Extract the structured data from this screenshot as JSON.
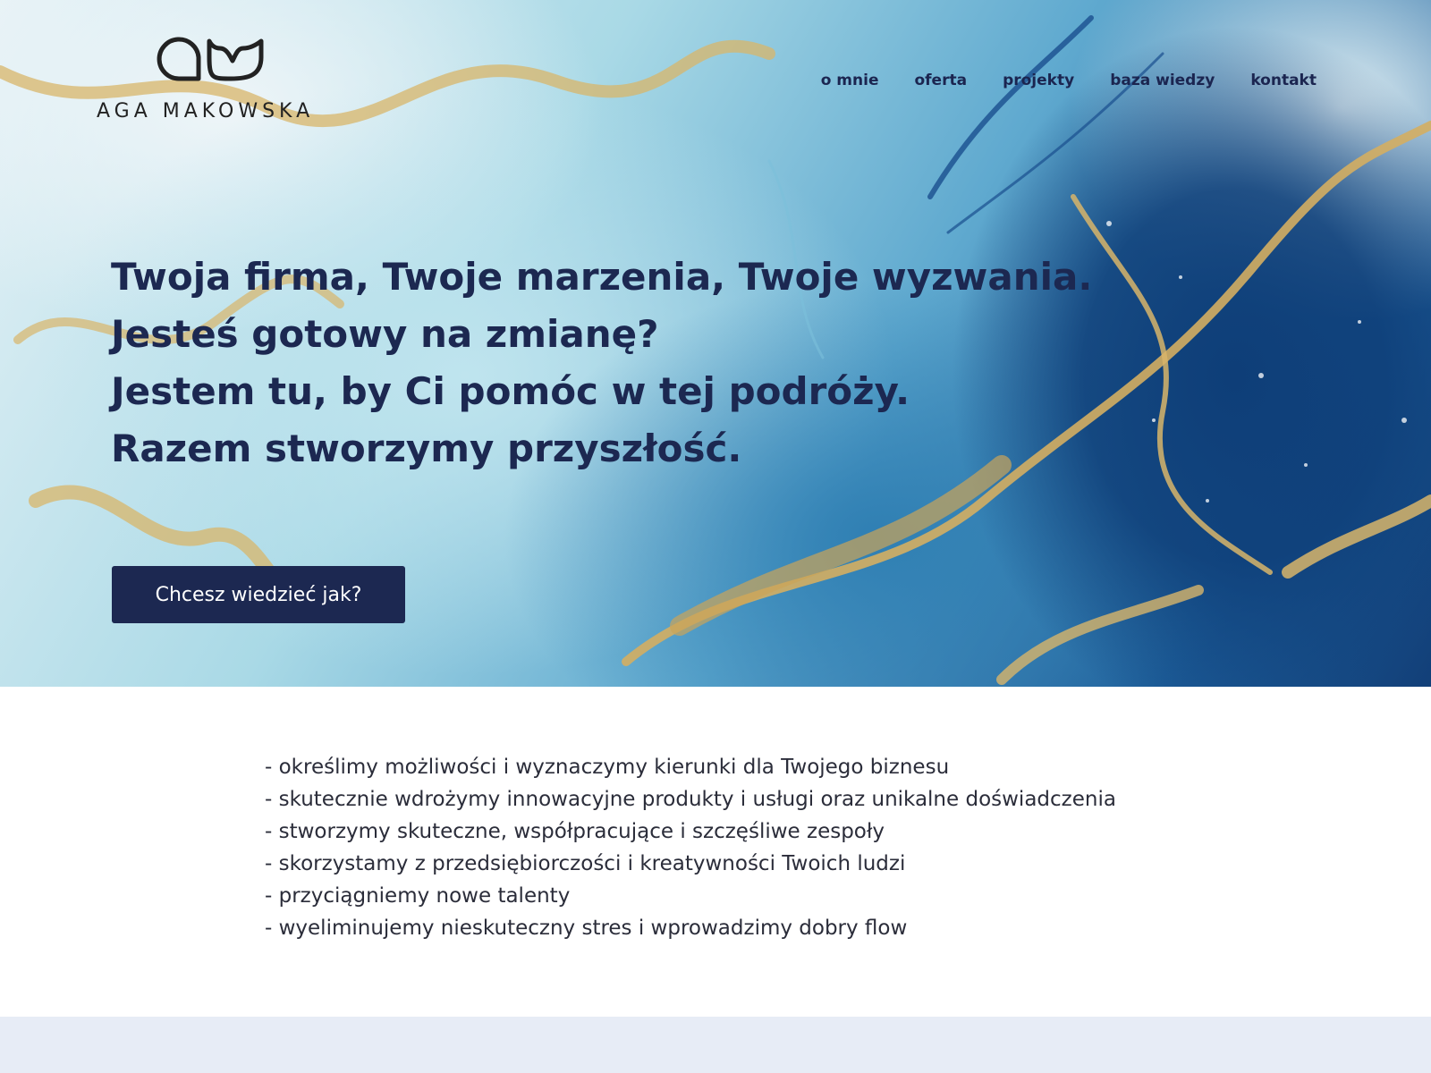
{
  "brand": {
    "name": "AGA MAKOWSKA",
    "logo_icon": "am-monogram-logo"
  },
  "nav": {
    "items": [
      {
        "label": "o mnie"
      },
      {
        "label": "oferta"
      },
      {
        "label": "projekty"
      },
      {
        "label": "baza wiedzy"
      },
      {
        "label": "kontakt"
      }
    ]
  },
  "hero": {
    "lines": [
      "Twoja firma, Twoje marzenia, Twoje wyzwania.",
      "Jesteś gotowy na zmianę?",
      "Jestem tu, by Ci pomóc w tej podróży.",
      "Razem stworzymy przyszłość."
    ],
    "cta_label": "Chcesz wiedzieć jak?"
  },
  "benefits": [
    "- określimy możliwości i wyznaczymy kierunki dla Twojego biznesu",
    "- skutecznie wdrożymy innowacyjne produkty i usługi oraz unikalne doświadczenia",
    "- stworzymy skuteczne, współpracujące i szczęśliwe zespoły",
    "- skorzystamy z przedsiębiorczości i kreatywności Twoich ludzi",
    "- przyciągniemy nowe talenty",
    "- wyeliminujemy nieskuteczny stres i wprowadzimy dobry flow"
  ],
  "colors": {
    "navy": "#1c2851",
    "gold": "#d8b56a",
    "text": "#2b2d3a",
    "footer_band": "#e7ecf6"
  }
}
